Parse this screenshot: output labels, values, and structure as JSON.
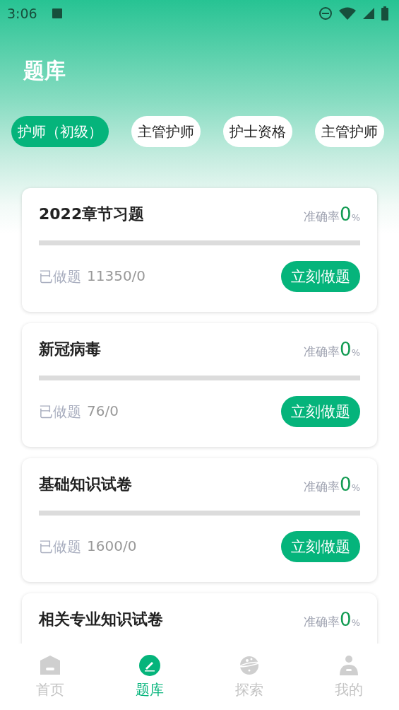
{
  "status_bar": {
    "time": "3:06"
  },
  "title": "题库",
  "chips": [
    {
      "label": "护师（初级）",
      "selected": true
    },
    {
      "label": "主管护师",
      "selected": false
    },
    {
      "label": "护士资格",
      "selected": false
    },
    {
      "label": "主管护师",
      "selected": false
    }
  ],
  "cards": [
    {
      "title": "2022章节习题",
      "rate_label": "准确率",
      "rate_value": "0",
      "rate_unit": "%",
      "level": 0,
      "done_label": "已做题",
      "done_count": "11350/0",
      "button": "立刻做题"
    },
    {
      "title": "新冠病毒",
      "rate_label": "准确率",
      "rate_value": "0",
      "rate_unit": "%",
      "level": 0,
      "done_label": "已做题",
      "done_count": "76/0",
      "button": "立刻做题"
    },
    {
      "title": "基础知识试卷",
      "rate_label": "准确率",
      "rate_value": "0",
      "rate_unit": "%",
      "level": 0,
      "done_label": "已做题",
      "done_count": "1600/0",
      "button": "立刻做题"
    },
    {
      "title": "相关专业知识试卷",
      "rate_label": "准确率",
      "rate_value": "0",
      "rate_unit": "%"
    }
  ],
  "tab_bar": [
    {
      "label": "首页",
      "kind": "home",
      "selected": false
    },
    {
      "label": "题库",
      "kind": "bank",
      "selected": true
    },
    {
      "label": "探索",
      "kind": "explore",
      "selected": false
    },
    {
      "label": "我的",
      "kind": "profile",
      "selected": false
    }
  ]
}
